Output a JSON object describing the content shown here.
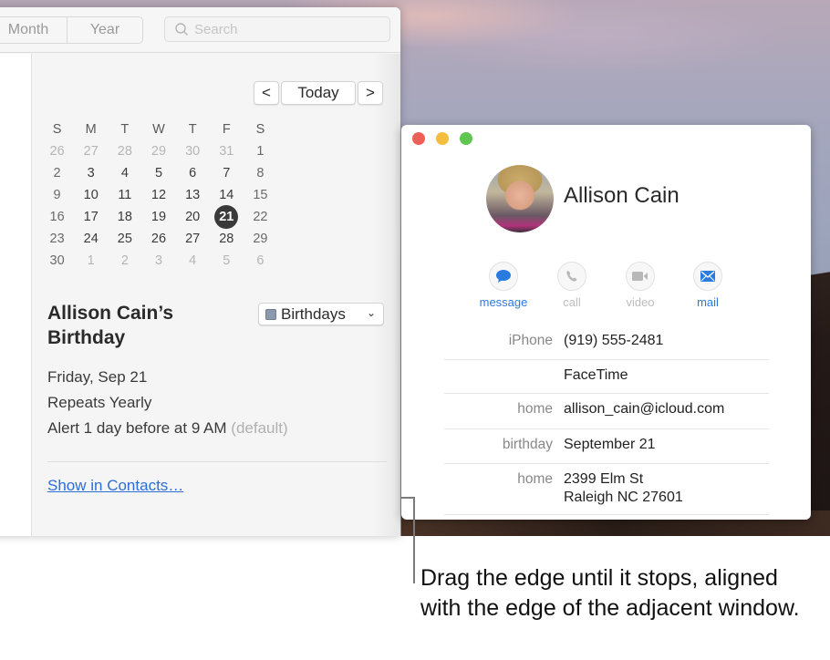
{
  "calendar_window": {
    "toolbar": {
      "view_tabs": [
        {
          "label": "Month"
        },
        {
          "label": "Year"
        }
      ],
      "search": {
        "placeholder": "Search",
        "value": ""
      }
    },
    "nav": {
      "prev_label": "<",
      "today_label": "Today",
      "next_label": ">"
    },
    "mini_calendar": {
      "weekday_headers": [
        "S",
        "M",
        "T",
        "W",
        "T",
        "F",
        "S"
      ],
      "selected_day": "21",
      "weeks": [
        [
          {
            "d": "26",
            "t": "other"
          },
          {
            "d": "27",
            "t": "other"
          },
          {
            "d": "28",
            "t": "other"
          },
          {
            "d": "29",
            "t": "other"
          },
          {
            "d": "30",
            "t": "other"
          },
          {
            "d": "31",
            "t": "other"
          },
          {
            "d": "1",
            "t": "weekend"
          }
        ],
        [
          {
            "d": "2",
            "t": "weekend"
          },
          {
            "d": "3",
            "t": "day"
          },
          {
            "d": "4",
            "t": "day"
          },
          {
            "d": "5",
            "t": "day"
          },
          {
            "d": "6",
            "t": "day"
          },
          {
            "d": "7",
            "t": "day"
          },
          {
            "d": "8",
            "t": "weekend"
          }
        ],
        [
          {
            "d": "9",
            "t": "weekend"
          },
          {
            "d": "10",
            "t": "day"
          },
          {
            "d": "11",
            "t": "day"
          },
          {
            "d": "12",
            "t": "day"
          },
          {
            "d": "13",
            "t": "day"
          },
          {
            "d": "14",
            "t": "day"
          },
          {
            "d": "15",
            "t": "weekend"
          }
        ],
        [
          {
            "d": "16",
            "t": "weekend"
          },
          {
            "d": "17",
            "t": "day"
          },
          {
            "d": "18",
            "t": "day"
          },
          {
            "d": "19",
            "t": "day"
          },
          {
            "d": "20",
            "t": "day"
          },
          {
            "d": "21",
            "t": "selected"
          },
          {
            "d": "22",
            "t": "weekend"
          }
        ],
        [
          {
            "d": "23",
            "t": "weekend"
          },
          {
            "d": "24",
            "t": "day"
          },
          {
            "d": "25",
            "t": "day"
          },
          {
            "d": "26",
            "t": "day"
          },
          {
            "d": "27",
            "t": "day"
          },
          {
            "d": "28",
            "t": "day"
          },
          {
            "d": "29",
            "t": "weekend"
          }
        ],
        [
          {
            "d": "30",
            "t": "weekend"
          },
          {
            "d": "1",
            "t": "other"
          },
          {
            "d": "2",
            "t": "other"
          },
          {
            "d": "3",
            "t": "other"
          },
          {
            "d": "4",
            "t": "other"
          },
          {
            "d": "5",
            "t": "other"
          },
          {
            "d": "6",
            "t": "other"
          }
        ]
      ]
    },
    "event": {
      "title_line1": "Allison Cain’s",
      "title_line2": "Birthday",
      "calendar_select": {
        "value": "Birthdays",
        "swatch_color": "#8d9aae"
      },
      "date": "Friday, Sep 21",
      "repeat": "Repeats Yearly",
      "alert": "Alert 1 day before at 9 AM",
      "alert_note": "(default)",
      "link": "Show in Contacts…"
    }
  },
  "contact_window": {
    "name": "Allison Cain",
    "actions": [
      {
        "label": "message",
        "icon": "message-bubble-icon",
        "state": "active"
      },
      {
        "label": "call",
        "icon": "phone-icon",
        "state": "disabled"
      },
      {
        "label": "video",
        "icon": "video-camera-icon",
        "state": "disabled"
      },
      {
        "label": "mail",
        "icon": "envelope-icon",
        "state": "active"
      }
    ],
    "fields": [
      {
        "label": "iPhone",
        "value": "(919) 555-2481"
      },
      {
        "label": "",
        "value": "FaceTime"
      },
      {
        "label": "home",
        "value": "allison_cain@icloud.com"
      },
      {
        "label": "birthday",
        "value": "September 21"
      },
      {
        "label": "home",
        "value": "2399 Elm St",
        "value2": "Raleigh NC 27601"
      }
    ],
    "accent_color": "#2a7be0"
  },
  "callout": {
    "text": "Drag the edge until it stops, aligned with the edge of the adjacent window."
  }
}
